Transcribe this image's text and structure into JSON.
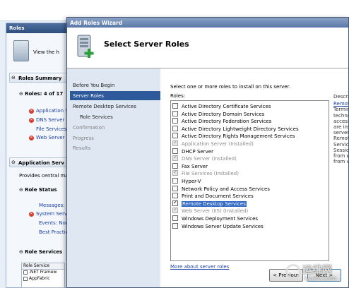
{
  "background": {
    "roles_header": "Roles",
    "view_text": "View the h",
    "roles_summary": "Roles Summary",
    "roles_count": "Roles:  4 of 17",
    "summary_items": [
      "Application S",
      "DNS Server",
      "File Services",
      "Web Server"
    ],
    "application_server_section": "Application Serv",
    "provides_text": "Provides central ma",
    "role_status": "Role Status",
    "status_items": [
      "Messages: N",
      "System Serv",
      "Events: Nor",
      "Best Practic"
    ],
    "role_services": "Role Services",
    "table_header": "Role Service",
    "table_rows": [
      ".NET Framew",
      "AppFabric"
    ]
  },
  "wizard": {
    "title": "Add Roles Wizard",
    "page_title": "Select Server Roles",
    "nav": {
      "before_you_begin": "Before You Begin",
      "server_roles": "Server Roles",
      "rds": "Remote Desktop Services",
      "role_services": "Role Services",
      "confirmation": "Confirmation",
      "progress": "Progress",
      "results": "Results"
    },
    "instruction": "Select one or more roles to install on this server.",
    "roles_label": "Roles:",
    "roles": [
      {
        "label": "Active Directory Certificate Services",
        "checked": false,
        "installed": false
      },
      {
        "label": "Active Directory Domain Services",
        "checked": false,
        "installed": false
      },
      {
        "label": "Active Directory Federation Services",
        "checked": false,
        "installed": false
      },
      {
        "label": "Active Directory Lightweight Directory Services",
        "checked": false,
        "installed": false
      },
      {
        "label": "Active Directory Rights Management Services",
        "checked": false,
        "installed": false
      },
      {
        "label": "Application Server  (Installed)",
        "checked": true,
        "installed": true
      },
      {
        "label": "DHCP Server",
        "checked": false,
        "installed": false
      },
      {
        "label": "DNS Server  (Installed)",
        "checked": true,
        "installed": true
      },
      {
        "label": "Fax Server",
        "checked": false,
        "installed": false
      },
      {
        "label": "File Services  (Installed)",
        "checked": true,
        "installed": true
      },
      {
        "label": "Hyper-V",
        "checked": false,
        "installed": false
      },
      {
        "label": "Network Policy and Access Services",
        "checked": false,
        "installed": false
      },
      {
        "label": "Print and Document Services",
        "checked": false,
        "installed": false
      },
      {
        "label": "Remote Desktop Services",
        "checked": true,
        "installed": false,
        "selected": true
      },
      {
        "label": "Web Server (IIS)  (Installed)",
        "checked": true,
        "installed": true
      },
      {
        "label": "Windows Deployment Services",
        "checked": false,
        "installed": false
      },
      {
        "label": "Windows Server Update Services",
        "checked": false,
        "installed": false
      }
    ],
    "more_link": "More about server roles",
    "description": {
      "label": "Descri",
      "link": "Remot",
      "lines": [
        "Termin",
        "techno",
        "access",
        "are ins",
        "server",
        "Remot",
        "Servic",
        "Sessio",
        "from w",
        "from v"
      ]
    },
    "buttons": {
      "previous": "< Previous",
      "next": "Next >"
    }
  },
  "watermark": {
    "cn": "运维网",
    "en": "iyunv.com"
  }
}
